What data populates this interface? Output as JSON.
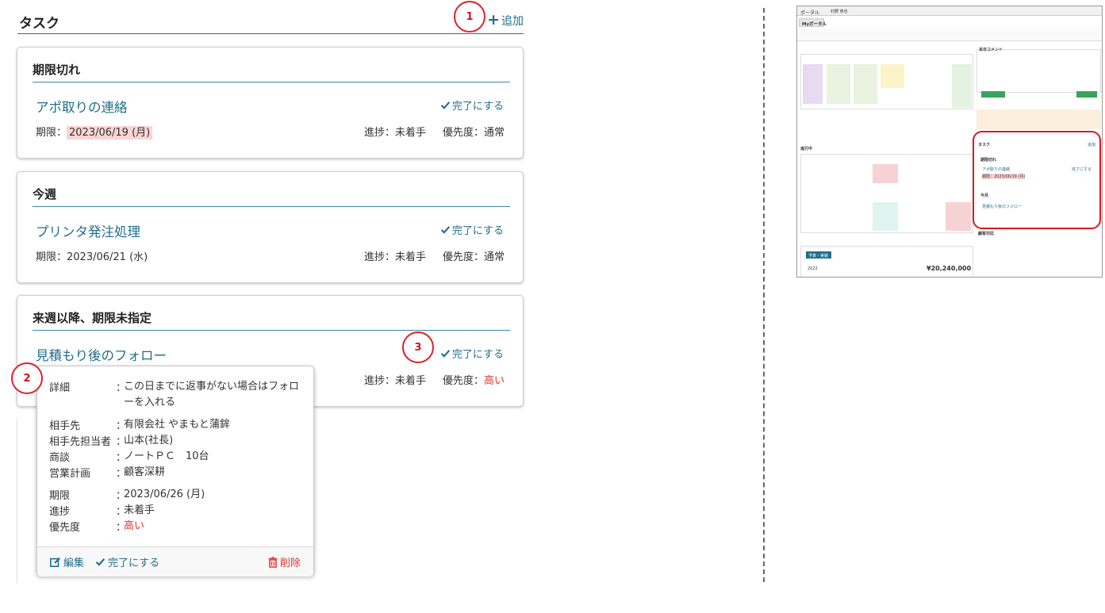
{
  "tasks_panel": {
    "title": "タスク",
    "add_label": "追加",
    "groups": [
      {
        "title": "期限切れ",
        "task": {
          "name": "アポ取りの連絡",
          "complete_label": "完了にする",
          "due_label": "期限：",
          "due_date": "2023/06/19 (月)",
          "progress": "進捗：未着手",
          "priority_label": "優先度：",
          "priority": "通常"
        }
      },
      {
        "title": "今週",
        "task": {
          "name": "プリンタ発注処理",
          "complete_label": "完了にする",
          "due_label": "期限：",
          "due_date": "2023/06/21 (水)",
          "progress": "進捗：未着手",
          "priority_label": "優先度：",
          "priority": "通常"
        }
      },
      {
        "title": "来週以降、期限未指定",
        "task": {
          "name": "見積もり後のフォロー",
          "complete_label": "完了にする",
          "progress": "進捗：未着手",
          "priority_label": "優先度：",
          "priority": "高い"
        }
      }
    ]
  },
  "badges": {
    "one": "1",
    "two": "2",
    "three": "3"
  },
  "popup": {
    "rows": [
      {
        "label": "詳細",
        "value": "この日までに返事がない場合はフォローを入れる"
      },
      {
        "label": "相手先",
        "value": "有限会社 やまもと蒲鉾"
      },
      {
        "label": "相手先担当者",
        "value": "山本(社長)"
      },
      {
        "label": "商談",
        "value": "ノートＰＣ　10台"
      },
      {
        "label": "営業計画",
        "value": "顧客深耕"
      },
      {
        "label": "期限",
        "value": "2023/06/26 (月)"
      },
      {
        "label": "進捗",
        "value": "未着手"
      },
      {
        "label": "優先度",
        "value": "高い"
      }
    ],
    "edit_label": "編集",
    "complete_label": "完了にする",
    "delete_label": "削除"
  },
  "thumbnail": {
    "portal_label": "ポータル",
    "user_label": "村野 修也",
    "my_portal": "Myポータル",
    "comment_header": "本日コメント",
    "tasks_header": "タスク",
    "add": "追加",
    "overdue": "期限切れ",
    "overdue_task": "アポ取りの連絡",
    "overdue_due": "期限：2023/06/19 (月)",
    "this_week": "今月",
    "week_task": "見積もり後のフォロー",
    "complete": "完了にする",
    "customer_header": "顧客対応",
    "in_progress": "進行中",
    "sales_tab": "予算・実績",
    "amount": "¥20,240,000",
    "year": "2022"
  }
}
